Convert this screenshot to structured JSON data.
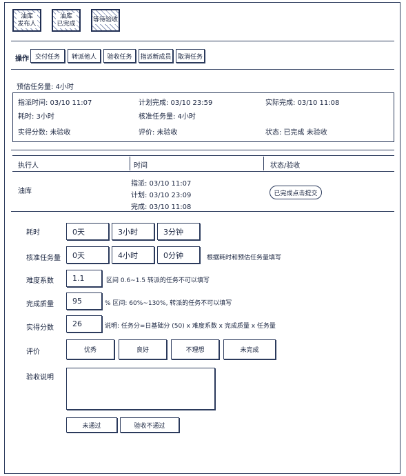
{
  "tabs": [
    "油库\n发布人",
    "油库\n已完成",
    "等待验收"
  ],
  "operation": {
    "label": "操作",
    "buttons": [
      "交付任务",
      "转派他人",
      "验收任务",
      "指派新成员",
      "取消任务"
    ]
  },
  "estimate": "预估任务量: 4小时",
  "summary": {
    "assign_time": "指派时间: 03/10 11:07",
    "plan_complete": "计划完成: 03/10 23:59",
    "actual_complete": "实际完成: 03/10 11:08",
    "time_used": "耗时: 3小时",
    "standard_work": "核准任务量: 4小时",
    "score": "实得分数: 未验收",
    "evaluation": "评价: 未验收",
    "status": "状态: 已完成 未验收"
  },
  "table": {
    "headers": [
      "执行人",
      "时间",
      "状态/验收"
    ],
    "row": {
      "executor": "油库",
      "times": [
        "指派: 03/10  11:07",
        "计划: 03/10  23:09",
        "完成: 03/10  11:08"
      ],
      "status_button": "已完成点击提交"
    }
  },
  "form": {
    "time_used": {
      "label": "耗时",
      "values": [
        "0天",
        "3小时",
        "3分钟"
      ]
    },
    "standard_work": {
      "label": "核准任务量",
      "values": [
        "0天",
        "4小时",
        "0分钟"
      ],
      "note": "根据耗时和预估任务量填写"
    },
    "difficulty": {
      "label": "难度系数",
      "value": "1.1",
      "note": "区间 0.6~1.5   转派的任务不可以填写"
    },
    "quality": {
      "label": "完成质量",
      "value": "95",
      "note": "%  区间: 60%~130%,   转派的任务不可以填写"
    },
    "score": {
      "label": "实得分数",
      "value": "26",
      "note": "说明: 任务分=日基础分 (50) x 难度系数 x 完成质量 x 任务量"
    },
    "evaluation": {
      "label": "评价",
      "options": [
        "优秀",
        "良好",
        "不理想",
        "未完成"
      ]
    },
    "description": {
      "label": "验收说明",
      "value": ""
    },
    "actions": [
      "未通过",
      "验收不通过"
    ]
  }
}
